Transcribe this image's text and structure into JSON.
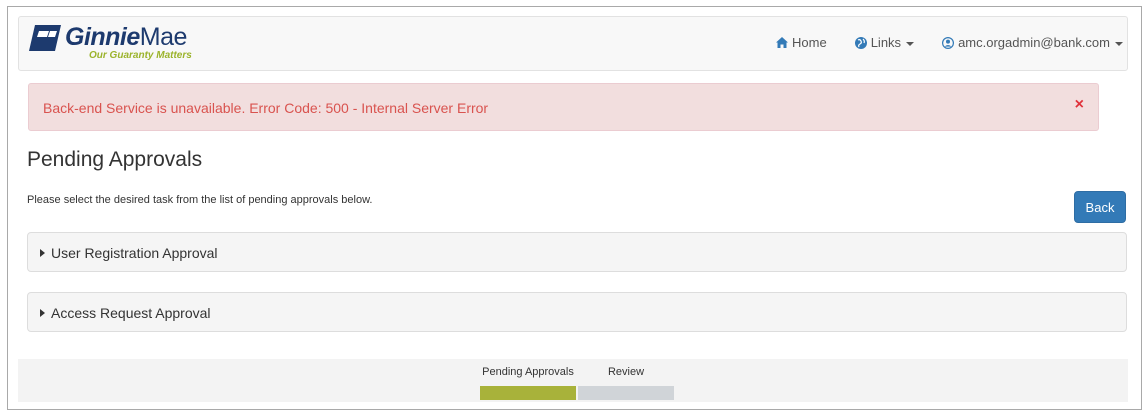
{
  "header": {
    "logo_brand_bold": "Ginnie",
    "logo_brand_light": "Mae",
    "logo_tagline": "Our Guaranty Matters",
    "nav": {
      "home_label": "Home",
      "links_label": "Links",
      "user_label": "amc.orgadmin@bank.com"
    }
  },
  "alert": {
    "message": "Back-end Service is unavailable. Error Code:  500 - Internal Server Error",
    "close_glyph": "×"
  },
  "main": {
    "title": "Pending Approvals",
    "instructions": "Please select the desired task from the list of pending approvals below.",
    "back_label": "Back",
    "panels": [
      {
        "label": "User Registration Approval"
      },
      {
        "label": "Access Request Approval"
      }
    ]
  },
  "progress": {
    "steps": [
      {
        "label": "Pending Approvals",
        "state": "active",
        "color": "#a8b23a"
      },
      {
        "label": "Review",
        "state": "inactive",
        "color": "#d0d4d8"
      }
    ]
  },
  "colors": {
    "brand_navy": "#1d3a6e",
    "brand_green": "#9bb32b",
    "alert_text": "#d9534f",
    "alert_bg": "#f2dede",
    "primary_button": "#337ab7"
  },
  "icons": {
    "home": "home-icon",
    "links": "globe-icon",
    "user": "user-circle-icon"
  }
}
